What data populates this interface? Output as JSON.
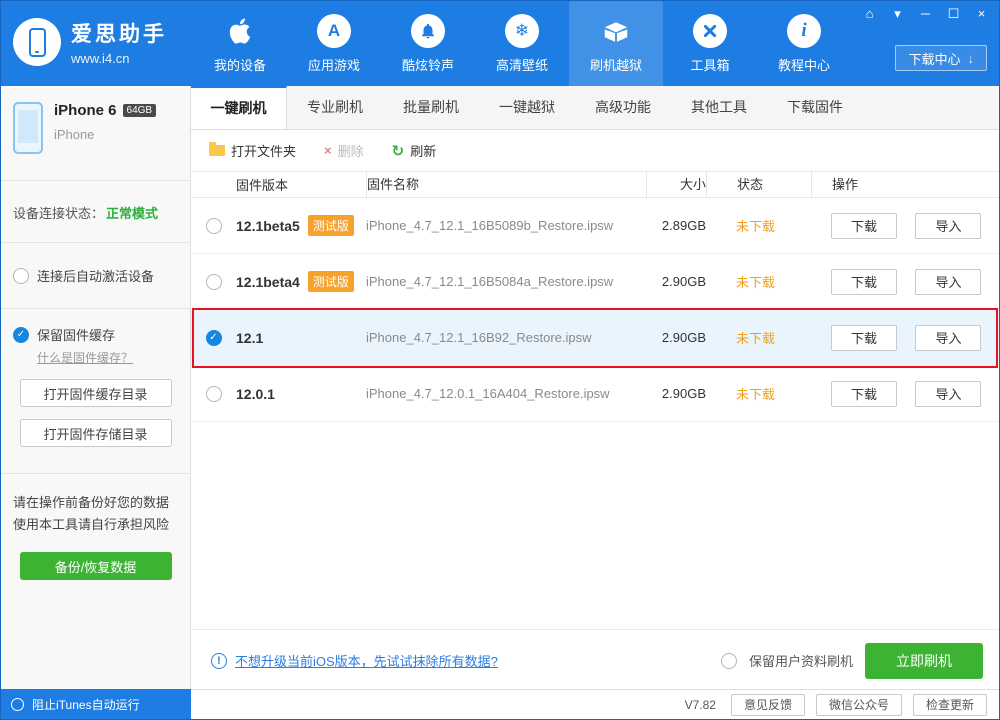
{
  "header": {
    "logo_title": "爱思助手",
    "logo_subtitle": "www.i4.cn",
    "nav": [
      {
        "label": "我的设备",
        "icon": "apple-icon"
      },
      {
        "label": "应用游戏",
        "icon": "appstore-icon"
      },
      {
        "label": "酷炫铃声",
        "icon": "bell-icon"
      },
      {
        "label": "高清壁纸",
        "icon": "wallpaper-icon"
      },
      {
        "label": "刷机越狱",
        "icon": "jailbreak-box-icon",
        "active": true
      },
      {
        "label": "工具箱",
        "icon": "toolbox-icon"
      },
      {
        "label": "教程中心",
        "icon": "tutorial-info-icon"
      }
    ],
    "download_center": "下载中心"
  },
  "window_controls": [
    "home",
    "theme",
    "minimize",
    "maximize",
    "close"
  ],
  "sidebar": {
    "device": {
      "name": "iPhone 6",
      "capacity": "64GB",
      "model": "iPhone"
    },
    "connection_label": "设备连接状态：",
    "connection_status": "正常模式",
    "auto_activate": "连接后自动激活设备",
    "keep_cache": "保留固件缓存",
    "what_is_cache": "什么是固件缓存？",
    "open_cache_dir": "打开固件缓存目录",
    "open_storage_dir": "打开固件存储目录",
    "warning_line1": "请在操作前备份好您的数据",
    "warning_line2": "使用本工具请自行承担风险",
    "backup_button": "备份/恢复数据",
    "block_itunes": "阻止iTunes自动运行"
  },
  "tabs": [
    "一键刷机",
    "专业刷机",
    "批量刷机",
    "一键越狱",
    "高级功能",
    "其他工具",
    "下载固件"
  ],
  "toolbar": {
    "open_folder": "打开文件夹",
    "delete": "删除",
    "refresh": "刷新"
  },
  "table": {
    "headers": [
      "固件版本",
      "固件名称",
      "大小",
      "状态",
      "操作"
    ],
    "download_label": "下载",
    "import_label": "导入",
    "rows": [
      {
        "version": "12.1beta5",
        "beta": "测试版",
        "name": "iPhone_4.7_12.1_16B5089b_Restore.ipsw",
        "size": "2.89GB",
        "status": "未下载",
        "selected": false
      },
      {
        "version": "12.1beta4",
        "beta": "测试版",
        "name": "iPhone_4.7_12.1_16B5084a_Restore.ipsw",
        "size": "2.90GB",
        "status": "未下载",
        "selected": false
      },
      {
        "version": "12.1",
        "beta": "",
        "name": "iPhone_4.7_12.1_16B92_Restore.ipsw",
        "size": "2.90GB",
        "status": "未下载",
        "selected": true
      },
      {
        "version": "12.0.1",
        "beta": "",
        "name": "iPhone_4.7_12.0.1_16A404_Restore.ipsw",
        "size": "2.90GB",
        "status": "未下载",
        "selected": false
      }
    ]
  },
  "footer": {
    "tip": "不想升级当前iOS版本，先试试抹除所有数据?",
    "keep_user_data": "保留用户资料刷机",
    "flash_button": "立即刷机"
  },
  "statusbar": {
    "version": "V7.82",
    "feedback": "意见反馈",
    "wechat": "微信公众号",
    "check_update": "检查更新"
  },
  "icons": {
    "home": "⌂",
    "theme": "▾",
    "minimize": "─",
    "maximize": "☐",
    "close": "×",
    "download": "↓",
    "appstore": "A",
    "wallpaper": "❄",
    "tutorial": "i",
    "delete": "×",
    "refresh": "↻",
    "check": "✓",
    "warn": "!"
  },
  "colors": {
    "accent_blue": "#1d7de2",
    "green": "#3db334",
    "badge_orange": "#f7a32b",
    "status_orange": "#f0a01e",
    "row_highlight": "#e9f4fd",
    "annotation_red": "#e8131e",
    "link_blue": "#2a7de1"
  }
}
